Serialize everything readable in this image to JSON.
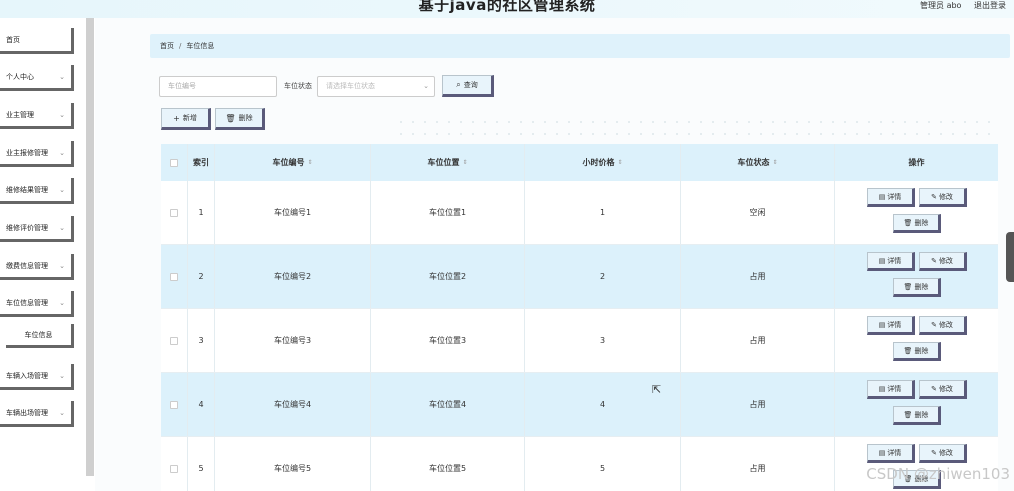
{
  "header": {
    "title": "基于java的社区管理系统",
    "user": "管理员 abo",
    "logout": "退出登录"
  },
  "sidebar": {
    "items": [
      {
        "label": "首页",
        "chevron": false
      },
      {
        "label": "个人中心",
        "chevron": true
      },
      {
        "label": "业主管理",
        "chevron": true
      },
      {
        "label": "业主报修管理",
        "chevron": true
      },
      {
        "label": "维修结果管理",
        "chevron": true
      },
      {
        "label": "维修评价管理",
        "chevron": true
      },
      {
        "label": "缴费信息管理",
        "chevron": true
      },
      {
        "label": "车位信息管理",
        "chevron": true
      },
      {
        "label": "车位信息",
        "chevron": false,
        "sub": true
      },
      {
        "label": "车辆入场管理",
        "chevron": true
      },
      {
        "label": "车辆出场管理",
        "chevron": true
      }
    ]
  },
  "breadcrumb": {
    "home": "首页",
    "sep": "/",
    "current": "车位信息"
  },
  "search": {
    "input_placeholder": "车位编号",
    "status_label": "车位状态",
    "status_placeholder": "请选择车位状态",
    "query_label": "查询",
    "query_icon": "search-icon"
  },
  "actions": {
    "add_label": "新增",
    "add_icon": "plus-icon",
    "delete_label": "删除",
    "delete_icon": "trash-icon"
  },
  "table": {
    "columns": [
      "索引",
      "车位编号",
      "车位位置",
      "小时价格",
      "车位状态",
      "操作"
    ],
    "rows": [
      {
        "index": "1",
        "code": "车位编号1",
        "position": "车位位置1",
        "price": "1",
        "status": "空闲"
      },
      {
        "index": "2",
        "code": "车位编号2",
        "position": "车位位置2",
        "price": "2",
        "status": "占用"
      },
      {
        "index": "3",
        "code": "车位编号3",
        "position": "车位位置3",
        "price": "3",
        "status": "占用"
      },
      {
        "index": "4",
        "code": "车位编号4",
        "position": "车位位置4",
        "price": "4",
        "status": "占用"
      },
      {
        "index": "5",
        "code": "车位编号5",
        "position": "车位位置5",
        "price": "5",
        "status": "占用"
      }
    ],
    "op_labels": {
      "detail": "详情",
      "edit": "修改",
      "delete": "删除"
    }
  },
  "watermark": "CSDN @zhiwen103"
}
